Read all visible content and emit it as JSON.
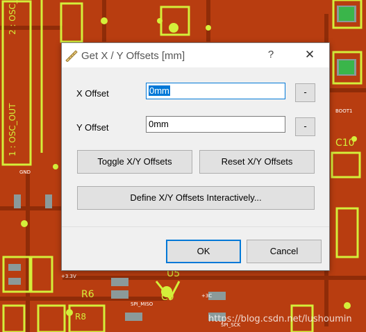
{
  "dialog": {
    "title": "Get X / Y Offsets [mm]",
    "help_label": "?",
    "close_label": "✕",
    "x_offset": {
      "label": "X Offset",
      "value": "0mm",
      "dash_label": "-"
    },
    "y_offset": {
      "label": "Y Offset",
      "value": "0mm",
      "dash_label": "-"
    },
    "toggle_label": "Toggle X/Y Offsets",
    "reset_label": "Reset X/Y Offsets",
    "define_label": "Define X/Y Offsets Interactively...",
    "ok_label": "OK",
    "cancel_label": "Cancel"
  },
  "background": {
    "labels": {
      "osc_top": "2 : OSC_",
      "osc_out": "1 : OSC_OUT",
      "c10": "C10",
      "r6": "R6",
      "u5": "U5",
      "r8": "R8",
      "c9": "C9",
      "spi_miso": "SPI_MISO",
      "spi_sck": "SPI_SCK",
      "v33": "+3.3V",
      "v3c": "+3C",
      "boot1": "BOOT1",
      "gnd": "GND"
    },
    "watermark": "https://blog.csdn.net/lushoumin"
  },
  "colors": {
    "board": "#b83d10",
    "silk": "#d4ef3a",
    "pad": "#7f8f8f",
    "accent": "#0078d7"
  }
}
